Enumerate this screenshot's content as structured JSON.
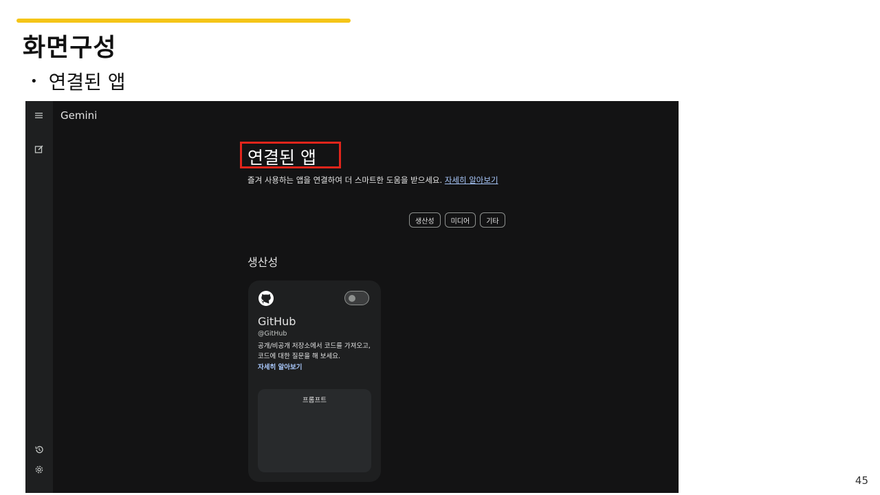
{
  "slide": {
    "title": "화면구성",
    "bullet": "연결된 앱",
    "page_number": "45"
  },
  "colors": {
    "accent_bar": "#f5c518",
    "highlight_border": "#e1251b",
    "screen_bg": "#131314",
    "link": "#a8c7fa"
  },
  "gemini": {
    "app_title": "Gemini",
    "sidebar_icons": [
      "menu-icon",
      "new-chat-icon",
      "history-icon",
      "settings-icon"
    ],
    "heading": "연결된 앱",
    "description": "즐겨 사용하는 앱을 연결하여 더 스마트한 도움을 받으세요.",
    "learn_more": "자세히 알아보기",
    "chips": [
      "생산성",
      "미디어",
      "기타"
    ],
    "section_heading": "생산성",
    "card": {
      "icon": "github-icon",
      "title": "GitHub",
      "handle": "@GitHub",
      "description": "공개/비공개 저장소에서 코드를 가져오고, 코드에 대한 질문을 해 보세요.",
      "link": "자세히 알아보기",
      "toggle_on": false,
      "prompt_label": "프롬프트"
    }
  }
}
